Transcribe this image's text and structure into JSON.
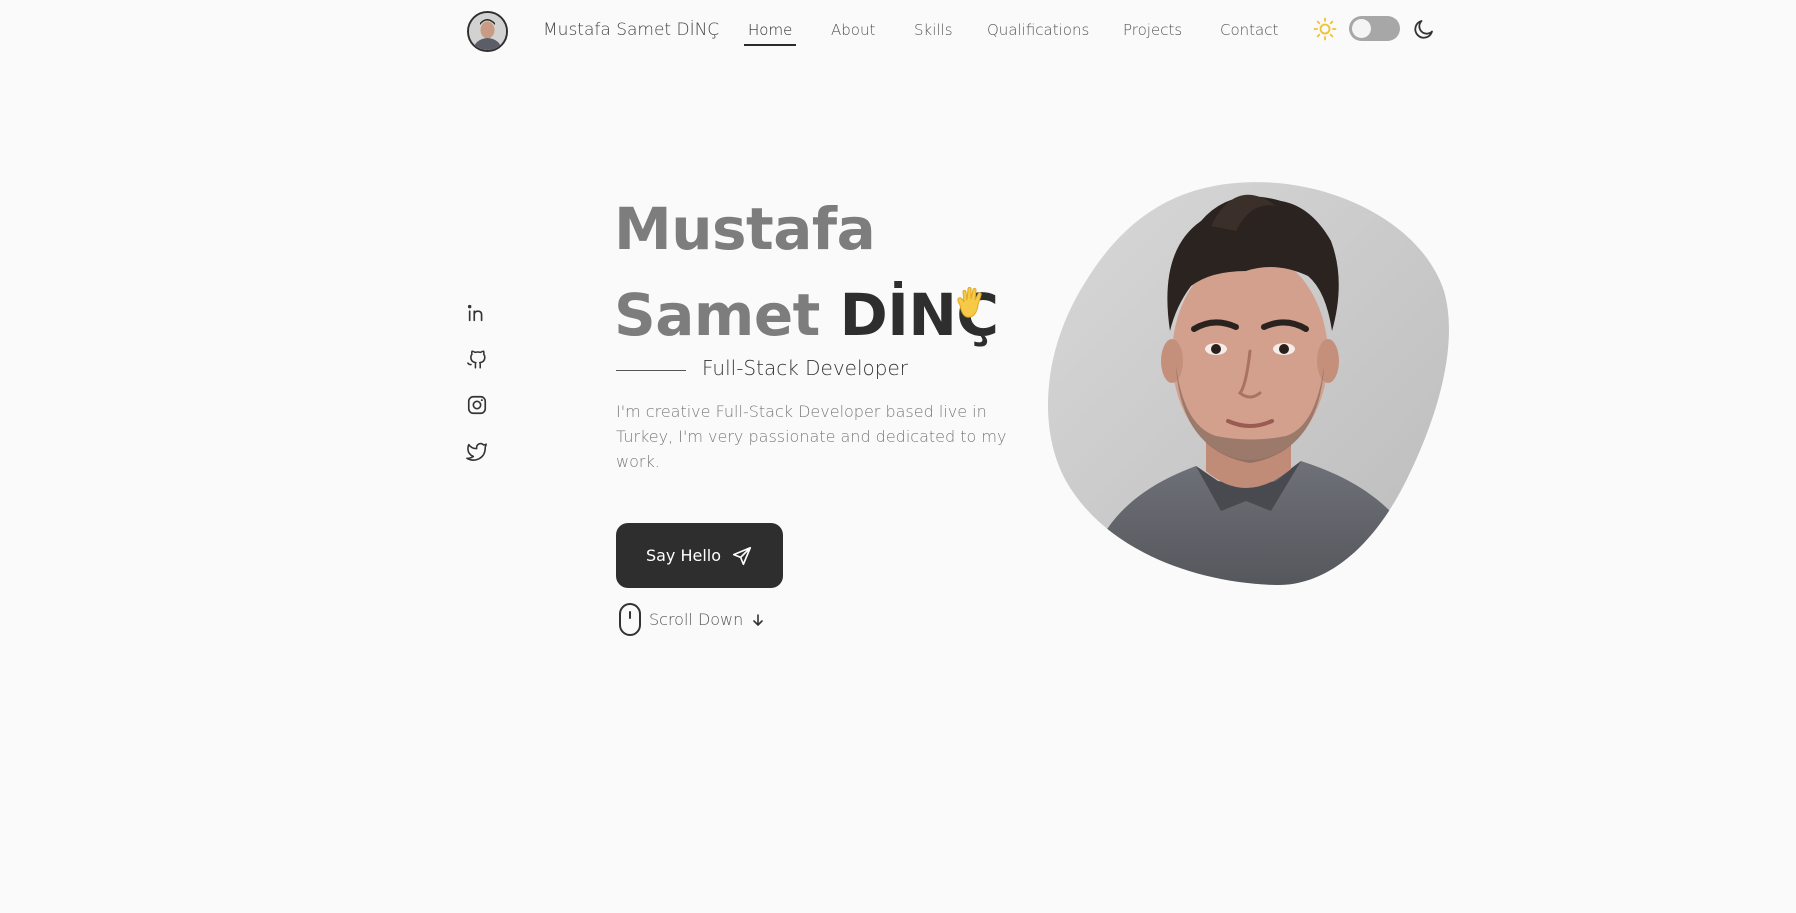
{
  "header": {
    "brand": "Mustafa Samet DİNÇ",
    "nav": [
      {
        "label": "Home",
        "active": true
      },
      {
        "label": "About",
        "active": false
      },
      {
        "label": "Skills",
        "active": false
      },
      {
        "label": "Qualifications",
        "active": false
      },
      {
        "label": "Projects",
        "active": false
      },
      {
        "label": "Contact",
        "active": false
      }
    ],
    "theme": {
      "light_icon": "sun-icon",
      "dark_icon": "moon-icon",
      "mode": "light"
    }
  },
  "social": [
    {
      "icon": "linkedin-icon"
    },
    {
      "icon": "github-icon"
    },
    {
      "icon": "instagram-icon"
    },
    {
      "icon": "twitter-icon"
    }
  ],
  "hero": {
    "first_name": "Mustafa",
    "middle_name": "Samet",
    "last_name": "DİNÇ",
    "subtitle": "Full-Stack Developer",
    "description": "I'm creative Full-Stack Developer based live in Turkey, I'm very passionate and dedicated to my work.",
    "cta_label": "Say Hello",
    "scroll_label": "Scroll Down"
  },
  "colors": {
    "background": "#fafafa",
    "dark": "#2e2e2e",
    "muted": "#7d7d7d",
    "sun": "#f2c12e"
  }
}
